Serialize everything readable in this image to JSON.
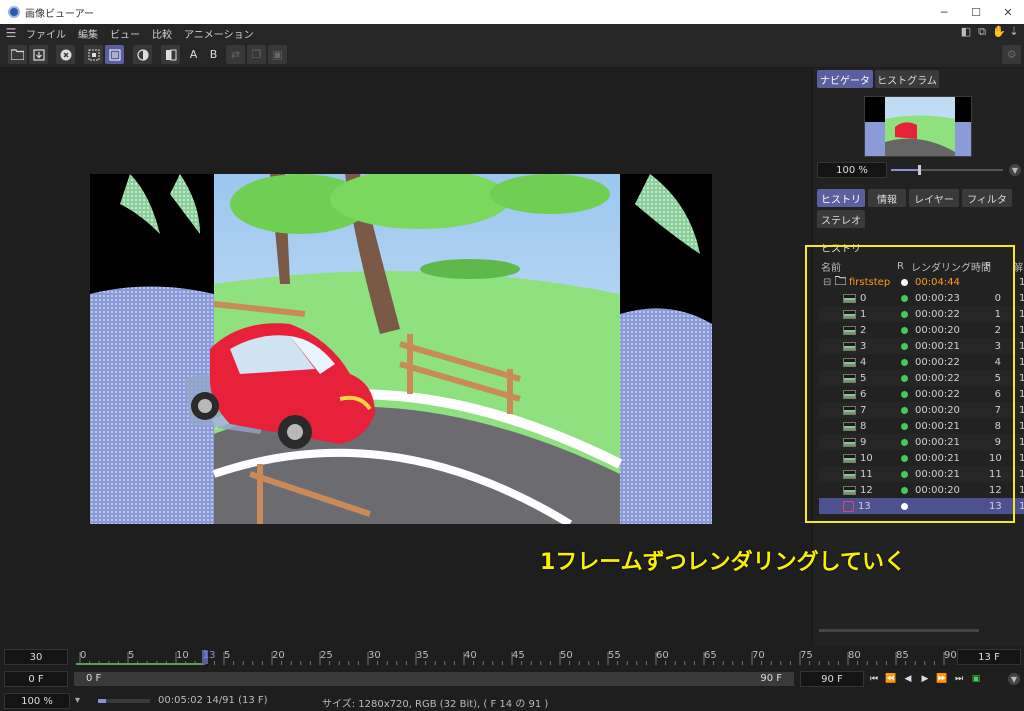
{
  "window": {
    "title": "画像ビューアー",
    "minimize": "─",
    "maximize": "☐",
    "close": "✕"
  },
  "menu": {
    "items": [
      "ファイル",
      "編集",
      "ビュー",
      "比較",
      "アニメーション"
    ]
  },
  "toolbar": {
    "a_label": "A",
    "b_label": "B"
  },
  "panel": {
    "tabs_top": [
      "ナビゲータ",
      "ヒストグラム"
    ],
    "zoom": "100 %",
    "tabs_mid": [
      "ヒストリ",
      "情報",
      "レイヤー",
      "フィルタ",
      "ステレオ"
    ],
    "history_title": "ヒストリ",
    "columns": {
      "name": "名前",
      "r": "R",
      "time": "レンダリング時間",
      "f": "F",
      "res": "解"
    },
    "root": {
      "name": "firststep",
      "time": "00:04:44",
      "res": "1"
    },
    "rows": [
      {
        "name": "0",
        "time": "00:00:23",
        "f": "0",
        "res": "1"
      },
      {
        "name": "1",
        "time": "00:00:22",
        "f": "1",
        "res": "1"
      },
      {
        "name": "2",
        "time": "00:00:20",
        "f": "2",
        "res": "1"
      },
      {
        "name": "3",
        "time": "00:00:21",
        "f": "3",
        "res": "1"
      },
      {
        "name": "4",
        "time": "00:00:22",
        "f": "4",
        "res": "1"
      },
      {
        "name": "5",
        "time": "00:00:22",
        "f": "5",
        "res": "1"
      },
      {
        "name": "6",
        "time": "00:00:22",
        "f": "6",
        "res": "1"
      },
      {
        "name": "7",
        "time": "00:00:20",
        "f": "7",
        "res": "1"
      },
      {
        "name": "8",
        "time": "00:00:21",
        "f": "8",
        "res": "1"
      },
      {
        "name": "9",
        "time": "00:00:21",
        "f": "9",
        "res": "1"
      },
      {
        "name": "10",
        "time": "00:00:21",
        "f": "10",
        "res": "1"
      },
      {
        "name": "11",
        "time": "00:00:21",
        "f": "11",
        "res": "1"
      },
      {
        "name": "12",
        "time": "00:00:20",
        "f": "12",
        "res": "1"
      },
      {
        "name": "13",
        "time": "",
        "f": "13",
        "res": "1"
      }
    ]
  },
  "callout": "1フレームずつレンダリングしていく",
  "timeline": {
    "fps": "30",
    "ticks": [
      "0",
      "5",
      "10",
      "13",
      "5",
      "20",
      "25",
      "30",
      "35",
      "40",
      "45",
      "50",
      "55",
      "60",
      "65",
      "70",
      "75",
      "80",
      "85",
      "90"
    ],
    "current_frame": "13 F",
    "start": "0 F",
    "range_start": "0 F",
    "range_end": "90 F",
    "end": "90 F"
  },
  "status": {
    "zoom": "100 %",
    "progress_text": "00:05:02 14/91 (13 F)",
    "progress_fraction": 0.15,
    "info": "サイズ: 1280x720, RGB (32 Bit), ( F 14 の 91 )"
  },
  "colors": {
    "accent": "#5b5f9e",
    "highlight": "#f3ec1a",
    "callout": "#f8f000",
    "done_dot": "#3ecf5a",
    "root_time": "#ff9a1f"
  }
}
